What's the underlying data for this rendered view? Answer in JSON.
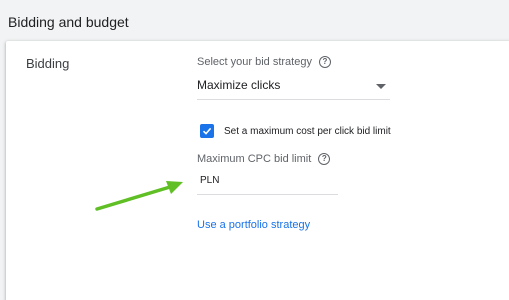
{
  "section": {
    "title": "Bidding and budget"
  },
  "bidding": {
    "label": "Bidding",
    "strategy": {
      "label": "Select your bid strategy",
      "selected": "Maximize clicks"
    },
    "max_cpc_checkbox": {
      "label": "Set a maximum cost per click bid limit",
      "checked": true
    },
    "max_cpc": {
      "label": "Maximum CPC bid limit",
      "currency": "PLN",
      "value": ""
    },
    "portfolio_link": "Use a portfolio strategy"
  },
  "annotation": {
    "color": "#5fbf24"
  },
  "colors": {
    "accent": "#1a73e8"
  }
}
